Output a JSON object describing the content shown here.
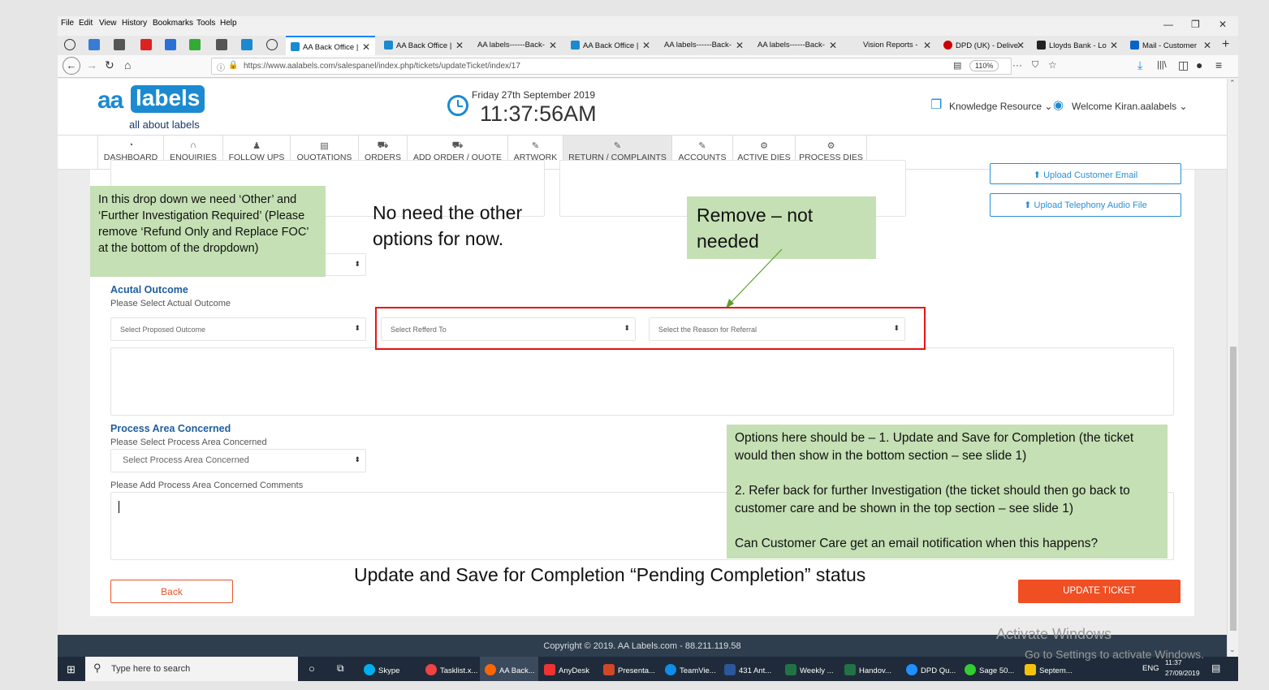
{
  "menubar": [
    "File",
    "Edit",
    "View",
    "History",
    "Bookmarks",
    "Tools",
    "Help"
  ],
  "tabs": [
    {
      "label": "AA Back Office | ",
      "active": true
    },
    {
      "label": "AA Back Office | ",
      "active": false
    },
    {
      "label": "AA labels------Back-",
      "active": false
    },
    {
      "label": "AA Back Office | ",
      "active": false
    },
    {
      "label": "AA labels------Back-",
      "active": false
    },
    {
      "label": "AA labels------Back-",
      "active": false
    },
    {
      "label": "Vision Reports - ",
      "active": false
    },
    {
      "label": "DPD (UK) - Delive",
      "active": false
    },
    {
      "label": "Lloyds Bank - Lo",
      "active": false
    },
    {
      "label": "Mail - Customer",
      "active": false
    }
  ],
  "url": "https://www.aalabels.com/salespanel/index.php/tickets/updateTicket/index/17",
  "zoom": "110%",
  "header": {
    "logo_aa": "aa",
    "logo_labels": "labels",
    "logo_sub": "all about labels",
    "date": "Friday 27th September 2019",
    "time": "11:37:56AM",
    "knowledge": "Knowledge Resource",
    "welcome": "Welcome Kiran.aalabels"
  },
  "nav": [
    {
      "label": "DASHBOARD",
      "icon": "dashboard-icon"
    },
    {
      "label": "ENQUIRIES",
      "icon": "headset-icon"
    },
    {
      "label": "FOLLOW UPS",
      "icon": "user-icon"
    },
    {
      "label": "QUOTATIONS",
      "icon": "document-icon"
    },
    {
      "label": "ORDERS",
      "icon": "cart-icon"
    },
    {
      "label": "ADD ORDER / QUOTE",
      "icon": "add-cart-icon"
    },
    {
      "label": "ARTWORK",
      "icon": "pencil-icon"
    },
    {
      "label": "RETURN / COMPLAINTS",
      "icon": "pencil-icon"
    },
    {
      "label": "ACCOUNTS",
      "icon": "pencil-icon"
    },
    {
      "label": "ACTIVE DIES",
      "icon": "gear-icon"
    },
    {
      "label": "PROCESS DIES",
      "icon": "gear-icon"
    }
  ],
  "form": {
    "upload_email": "Upload Customer Email",
    "upload_audio": "Upload Telephony Audio File",
    "actual_outcome_title": "Acutal Outcome",
    "actual_outcome_hint": "Please Select Actual Outcome",
    "proposed_outcome_placeholder": "Select Proposed Outcome",
    "referred_to_placeholder": "Select Refferd To",
    "referral_reason_placeholder": "Select the Reason for Referral",
    "process_area_title": "Process Area Concerned",
    "process_area_hint": "Please Select Process Area Concerned",
    "process_area_placeholder": "Select Process Area Concerned",
    "process_comments_label": "Please Add Process Area Concerned Comments",
    "back_button": "Back",
    "update_button": "UPDATE TICKET"
  },
  "footer": "Copyright © 2019. AA Labels.com - 88.211.119.58",
  "annotations": {
    "dropdown_note": "In this drop down we need ‘Other’ and ‘Further Investigation Required’ (Please remove ‘Refund Only and Replace FOC’ at the bottom of the dropdown)",
    "no_need": "No need the other options for now.",
    "remove": "Remove – not needed",
    "options_1": "Options here should be – 1. Update and Save for Completion (the ticket would then show in the bottom section – see slide 1)",
    "options_2": "2. Refer back for further Investigation  (the ticket should then go back to customer care and be shown in the top section – see slide 1)",
    "options_3": "Can Customer Care get an email notification when this happens?",
    "pending": "Update and Save for Completion “Pending Completion” status"
  },
  "taskbar": {
    "search": "Type here to search",
    "items": [
      "Skype",
      "Tasklist.x...",
      "AA Back...",
      "AnyDesk",
      "Presenta...",
      "TeamVie...",
      "431 Ant...",
      "Weekly ...",
      "Handov...",
      "DPD Qu...",
      "Sage 50...",
      "Septem..."
    ],
    "lang": "ENG",
    "clock_time": "11:37",
    "clock_date": "27/09/2019"
  },
  "watermark": {
    "line1": "Activate Windows",
    "line2": "Go to Settings to activate Windows."
  },
  "colors": {
    "brand": "#1b8ad1",
    "accent": "#f04e23",
    "callout": "#c5e0b4",
    "heading": "#1f5d9e"
  }
}
